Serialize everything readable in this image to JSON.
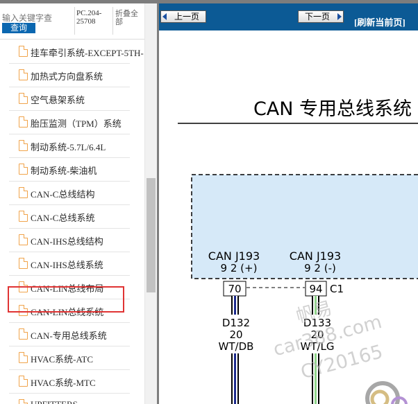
{
  "search": {
    "placeholder": "输入关键字查",
    "button_label": "查询"
  },
  "header": {
    "code": "PC.204-25708",
    "collapse_all": "折叠全部"
  },
  "tree": {
    "items": [
      {
        "label": "挂车牵引系统-EXCEPT-5TH-"
      },
      {
        "label": "加热式方向盘系统"
      },
      {
        "label": "空气悬架系统"
      },
      {
        "label": "胎压监测（TPM）系统"
      },
      {
        "label": "制动系统-5.7L/6.4L"
      },
      {
        "label": "制动系统-柴油机"
      },
      {
        "label": "CAN-C总线结构"
      },
      {
        "label": "CAN-C总线系统"
      },
      {
        "label": "CAN-IHS总线结构"
      },
      {
        "label": "CAN-IHS总线系统"
      },
      {
        "label": "CAN-LIN总线布局"
      },
      {
        "label": "CAN-LIN总线系统"
      },
      {
        "label": "CAN-专用总线系统",
        "selected": true
      },
      {
        "label": "HVAC系统-ATC"
      },
      {
        "label": "HVAC系统-MTC"
      },
      {
        "label": "UPFITTERS"
      }
    ]
  },
  "nav": {
    "prev_label": "上一页",
    "next_label": "下一页",
    "refresh_label": "[刷新当前页]"
  },
  "diagram": {
    "title": "CAN 专用总线系统",
    "connectors": [
      {
        "name_line1": "CAN J193",
        "name_line2": "9 2 (+)",
        "pin": "70",
        "wire": "D132",
        "gauge": "20",
        "color_code": "WT/DB",
        "stripe": "#1c2a8c"
      },
      {
        "name_line1": "CAN J193",
        "name_line2": "9 2 (-)",
        "pin": "94",
        "wire": "D133",
        "gauge": "20",
        "color_code": "WT/LG",
        "stripe": "#8fd48a"
      }
    ],
    "connector_label": "C1",
    "watermark_lines": [
      "帆易",
      "car388.com",
      "CY20165"
    ],
    "module_fill": "#d6e9f8"
  },
  "colors": {
    "nav_bg": "#0c5a95",
    "search_btn": "#0b67b0",
    "selection": "#e03333",
    "doc_icon": "#f0a34a"
  }
}
